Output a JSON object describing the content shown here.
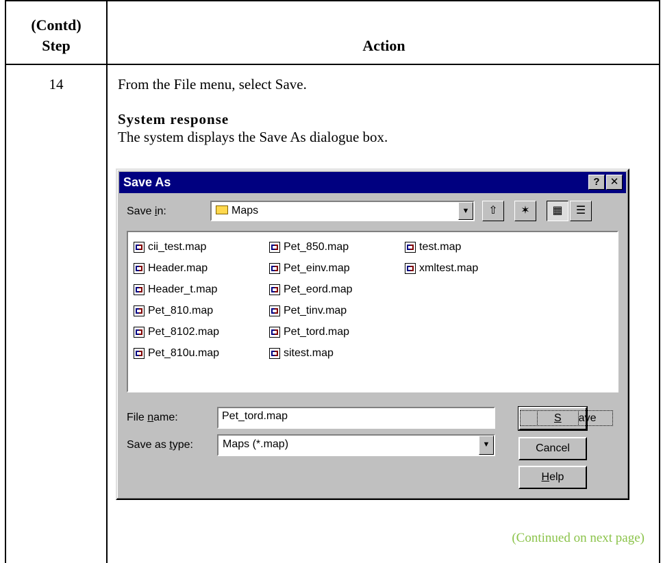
{
  "table": {
    "step_header_line1": "(Contd)",
    "step_header_line2": "Step",
    "action_header": "Action",
    "step_number": "14",
    "instruction": "From the File menu, select Save.",
    "response_title": "System response",
    "response_text": "The system displays the Save As dialogue box.",
    "continued": "(Continued on next page)"
  },
  "dialog": {
    "title": "Save As",
    "help_btn": "?",
    "close_btn": "✕",
    "save_in_label": "Save in:",
    "save_in_value": "Maps",
    "files_col1": [
      "cii_test.map",
      "Header.map",
      "Header_t.map",
      "Pet_810.map",
      "Pet_8102.map",
      "Pet_810u.map"
    ],
    "files_col2": [
      "Pet_850.map",
      "Pet_einv.map",
      "Pet_eord.map",
      "Pet_tinv.map",
      "Pet_tord.map",
      "sitest.map"
    ],
    "files_col3": [
      "test.map",
      "xmltest.map"
    ],
    "file_name_label": "File name:",
    "file_name_value": "Pet_tord.map",
    "save_as_type_label": "Save as type:",
    "save_as_type_value": "Maps (*.map)",
    "save_button": "Save",
    "cancel_button": "Cancel",
    "help_button": "Help"
  }
}
